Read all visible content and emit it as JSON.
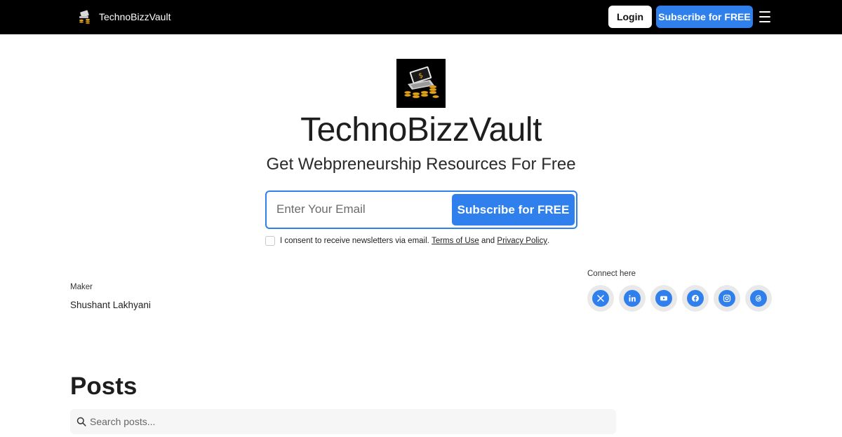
{
  "header": {
    "brand_name": "TechnoBizzVault",
    "login_label": "Login",
    "subscribe_label": "Subscribe for FREE"
  },
  "hero": {
    "title": "TechnoBizzVault",
    "subtitle": "Get Webpreneurship Resources For Free",
    "email_placeholder": "Enter Your Email",
    "subscribe_label": "Subscribe for FREE",
    "consent_text": "I consent to receive newsletters via email.",
    "terms_label": "Terms of Use",
    "and_text": "and",
    "privacy_label": "Privacy Policy",
    "period": "."
  },
  "maker": {
    "label": "Maker",
    "name": "Shushant Lakhyani"
  },
  "connect": {
    "label": "Connect here",
    "icons": [
      "x-icon",
      "linkedin-icon",
      "youtube-icon",
      "facebook-icon",
      "instagram-icon",
      "threads-icon"
    ]
  },
  "posts": {
    "heading": "Posts",
    "search_placeholder": "Search posts..."
  },
  "colors": {
    "accent": "#2f80ed",
    "header_bg": "#000000",
    "social_ring": "#e9e9e9"
  }
}
